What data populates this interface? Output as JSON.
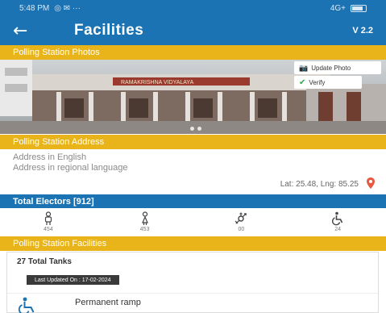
{
  "status_bar": {
    "time": "5:48 PM",
    "signal": "4G+"
  },
  "app_bar": {
    "title": "Facilities",
    "version": "V 2.2"
  },
  "sections": {
    "photos": "Polling Station Photos",
    "address": "Polling Station Address",
    "electors": "Total Electors [912]",
    "facilities": "Polling Station Facilities"
  },
  "photo": {
    "update_label": "Update Photo",
    "verify_label": "Verify",
    "sign_text": "RAMAKRISHNA VIDYALAYA"
  },
  "address": {
    "english": "Address in English",
    "regional": "Address in regional language",
    "latlng": "Lat: 25.48, Lng: 85.25"
  },
  "electors": [
    {
      "icon": "male-icon",
      "count": "454"
    },
    {
      "icon": "female-icon",
      "count": "453"
    },
    {
      "icon": "third-gender-icon",
      "count": "00"
    },
    {
      "icon": "wheelchair-icon",
      "count": "24"
    }
  ],
  "facilities": {
    "total_tanks": "27 Total Tanks",
    "last_updated": "Last Updated On : 17-02-2024",
    "items": [
      {
        "icon": "wheelchair-icon",
        "label": "Permanent ramp"
      }
    ]
  },
  "colors": {
    "primary": "#1b73b3",
    "accent": "#e8b41a",
    "pin": "#e8573f"
  }
}
